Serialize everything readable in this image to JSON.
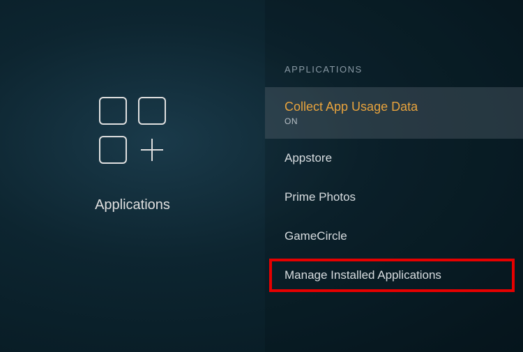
{
  "left": {
    "label": "Applications"
  },
  "right": {
    "header": "APPLICATIONS",
    "items": [
      {
        "title": "Collect App Usage Data",
        "sub": "ON"
      },
      {
        "title": "Appstore"
      },
      {
        "title": "Prime Photos"
      },
      {
        "title": "GameCircle"
      },
      {
        "title": "Manage Installed Applications"
      }
    ]
  }
}
